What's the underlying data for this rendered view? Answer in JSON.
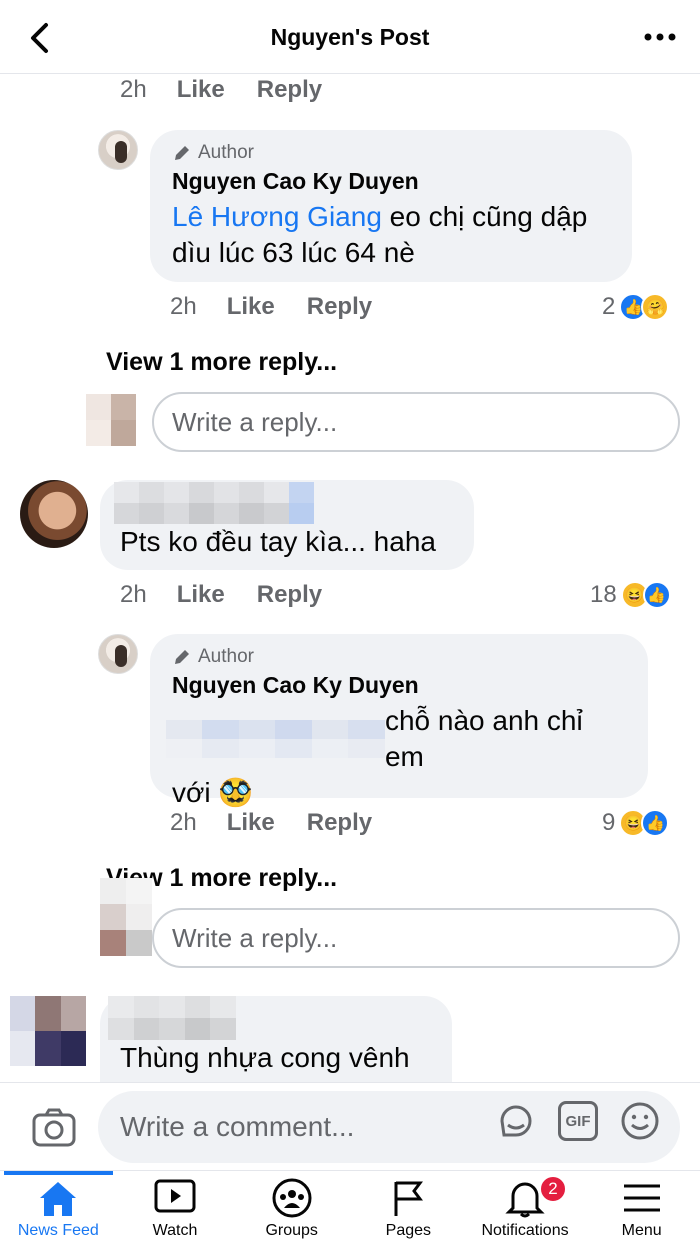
{
  "header": {
    "title": "Nguyen's Post"
  },
  "top_actions": {
    "time": "2h",
    "like": "Like",
    "reply": "Reply"
  },
  "reply1": {
    "author_tag": "Author",
    "name": "Nguyen Cao Ky Duyen",
    "mention": "Lê Hương Giang",
    "text_after_mention": " eo chị cũng dập dìu lúc 63 lúc 64 nè",
    "time": "2h",
    "like": "Like",
    "reply": "Reply",
    "reaction_count": "2"
  },
  "view_more_1": "View 1 more reply...",
  "reply_input_1": "Write a reply...",
  "comment2": {
    "text": "Pts ko đều tay kìa... haha",
    "time": "2h",
    "like": "Like",
    "reply": "Reply",
    "reaction_count": "18"
  },
  "reply2": {
    "author_tag": "Author",
    "name": "Nguyen Cao Ky Duyen",
    "text_line1": "chỗ nào anh chỉ em",
    "text_line2": "với",
    "emoji": "🥸",
    "time": "2h",
    "like": "Like",
    "reply": "Reply",
    "reaction_count": "9"
  },
  "view_more_2": "View 1 more reply...",
  "reply_input_2": "Write a reply...",
  "comment3": {
    "text": "Thùng nhựa cong vênh"
  },
  "comment_bar": {
    "placeholder": "Write a comment...",
    "gif": "GIF"
  },
  "tabs": [
    {
      "label": "News Feed",
      "icon": "home-icon"
    },
    {
      "label": "Watch",
      "icon": "watch-icon"
    },
    {
      "label": "Groups",
      "icon": "groups-icon"
    },
    {
      "label": "Pages",
      "icon": "flag-icon"
    },
    {
      "label": "Notifications",
      "icon": "bell-icon",
      "badge": "2"
    },
    {
      "label": "Menu",
      "icon": "menu-icon"
    }
  ],
  "colors": {
    "accent": "#1877f2",
    "bubble": "#f0f2f5",
    "muted": "#65676b",
    "badge": "#e41e3f"
  }
}
